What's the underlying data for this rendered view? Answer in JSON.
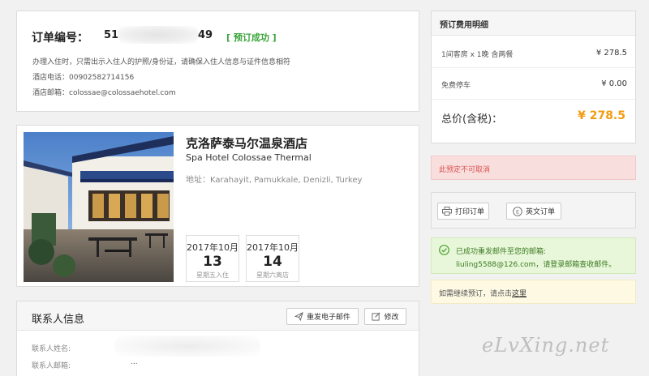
{
  "order": {
    "title": "订单编号：",
    "number_prefix": "51",
    "number_suffix": "49",
    "status": "[ 预订成功 ]",
    "checkin_note": "办理入住时，只需出示入住人的护照/身份证，请确保入住人信息与证件信息相符",
    "hotel_phone": "酒店电话：00902582714156",
    "hotel_email": "酒店邮箱：colossae@colossaehotel.com"
  },
  "hotel": {
    "name_cn": "克洛萨泰马尔温泉酒店",
    "name_en": "Spa Hotel Colossae Thermal",
    "address": "地址：Karahayit, Pamukkale, Denizli, Turkey",
    "checkin": {
      "month": "2017年10月",
      "day": "13",
      "label": "星期五入住"
    },
    "checkout": {
      "month": "2017年10月",
      "day": "14",
      "label": "星期六离店"
    }
  },
  "contact": {
    "title": "联系人信息",
    "resend_label": "重发电子邮件",
    "edit_label": "修改",
    "name_label": "联系人姓名:",
    "email_label": "联系人邮箱:",
    "email_value": "..."
  },
  "price": {
    "title": "预订费用明细",
    "items": [
      {
        "label": "1间客房 x 1晚   含两餐",
        "value": "¥ 278.5"
      },
      {
        "label": "免费停车",
        "value": "¥ 0.00"
      }
    ],
    "total_label": "总价(含税)：",
    "total_value": "¥ 278.5"
  },
  "notices": {
    "cancel": "此预定不可取消",
    "email_line1": "已成功重发邮件至您的邮箱:",
    "email_line2": "liuling5588@126.com，请登录邮箱查收邮件。",
    "rebook_text": "如需继续预订，请点击",
    "rebook_link": "这里"
  },
  "actions": {
    "print_label": "打印订单",
    "english_label": "英文订单"
  },
  "watermark": "eLvXing.net",
  "colors": {
    "status_green": "#3aa53a",
    "price_orange": "#f29b12",
    "cancel_red": "#d9534f"
  }
}
